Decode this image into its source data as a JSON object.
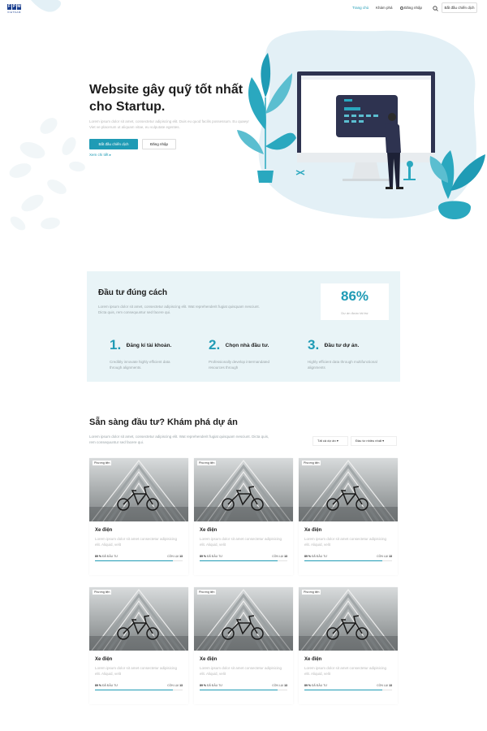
{
  "header": {
    "logo_letters": [
      "F",
      "P",
      "M"
    ],
    "logo_sub": "VIETNAM",
    "nav": [
      {
        "label": "Trang chủ",
        "active": true
      },
      {
        "label": "Khám phá",
        "active": false
      },
      {
        "label": "Đăng nhập",
        "active": false
      }
    ],
    "cta": "Bắt đầu chiến dịch"
  },
  "hero": {
    "title_line1": "Website gây quỹ tốt nhất",
    "title_line2": "cho Startup.",
    "description": "Lorem ipsum dolor sit amet, consectetur adipiscing elit. Duis eu quod facilis possessum. Eu quaeyr Viet ve placerum ut aliquam vitae, eu vulputate egentes.",
    "primary_button": "Bắt đầu chiến dịch",
    "secondary_button": "Đăng nhập",
    "link": "Xem chi tiết ▸"
  },
  "invest": {
    "title": "Đầu tư đúng cách",
    "description": "Lorem ipsum dolor sit amet, consectetur adipiscing elit. Wat reprehenderit fugiat quisquam nesciunt. Dicta quis, rem consequuntur sed facere qui.",
    "stat_value": "86%",
    "stat_label": "Dự án được tài trợ",
    "steps": [
      {
        "num": "1.",
        "title": "Đăng kí tài khoản.",
        "desc": "Credibly innovate highly efficient data through alignments."
      },
      {
        "num": "2.",
        "title": "Chọn nhà đầu tư.",
        "desc": "Professionally develop intermandated resources through"
      },
      {
        "num": "3.",
        "title": "Đầu tư dự án.",
        "desc": "Highly efficient data through multifunctional alignments"
      }
    ]
  },
  "projects": {
    "title": "Sẵn sàng đầu tư? Khám phá dự án",
    "description": "Lorem ipsum dolor sit amet, consectetur adipiscing elit. Wat reprehenderit fugiat quisquam nesciunt. Dicta quis, rem consequuntur sed facere qui.",
    "filter_all": "Tất cả dự án",
    "filter_sort": "Đầu tư nhiều nhất",
    "cards": [
      {
        "badge": "Phương tiện",
        "title": "Xe điện",
        "desc": "Lorem ipsum dolor sit amet consectetur adipisicing elit. Aliquid, velit",
        "funded_pct": "89 %",
        "funded_label": "ĐÃ ĐẦU TƯ",
        "left_label": "CÒN LẠI",
        "left_days": "13",
        "progress": 0.89
      },
      {
        "badge": "Phương tiện",
        "title": "Xe điện",
        "desc": "Lorem ipsum dolor sit amet consectetur adipisicing elit. Aliquid, velit",
        "funded_pct": "89 %",
        "funded_label": "ĐÃ ĐẦU TƯ",
        "left_label": "CÒN LẠI",
        "left_days": "13",
        "progress": 0.89
      },
      {
        "badge": "Phương tiện",
        "title": "Xe điện",
        "desc": "Lorem ipsum dolor sit amet consectetur adipisicing elit. Aliquid, velit",
        "funded_pct": "89 %",
        "funded_label": "ĐÃ ĐẦU TƯ",
        "left_label": "CÒN LẠI",
        "left_days": "13",
        "progress": 0.89
      },
      {
        "badge": "Phương tiện",
        "title": "Xe điện",
        "desc": "Lorem ipsum dolor sit amet consectetur adipisicing elit. Aliquid, velit",
        "funded_pct": "89 %",
        "funded_label": "ĐÃ ĐẦU TƯ",
        "left_label": "CÒN LẠI",
        "left_days": "13",
        "progress": 0.89
      },
      {
        "badge": "Phương tiện",
        "title": "Xe điện",
        "desc": "Lorem ipsum dolor sit amet consectetur adipisicing elit. Aliquid, velit",
        "funded_pct": "89 %",
        "funded_label": "ĐÃ ĐẦU TƯ",
        "left_label": "CÒN LẠI",
        "left_days": "13",
        "progress": 0.89
      },
      {
        "badge": "Phương tiện",
        "title": "Xe điện",
        "desc": "Lorem ipsum dolor sit amet consectetur adipisicing elit. Aliquid, velit",
        "funded_pct": "89 %",
        "funded_label": "ĐÃ ĐẦU TƯ",
        "left_label": "CÒN LẠI",
        "left_days": "13",
        "progress": 0.89
      }
    ]
  },
  "colors": {
    "accent": "#1f9bb5",
    "hero_blob": "#e3f0f6",
    "dark_text": "#1d1d1d"
  }
}
